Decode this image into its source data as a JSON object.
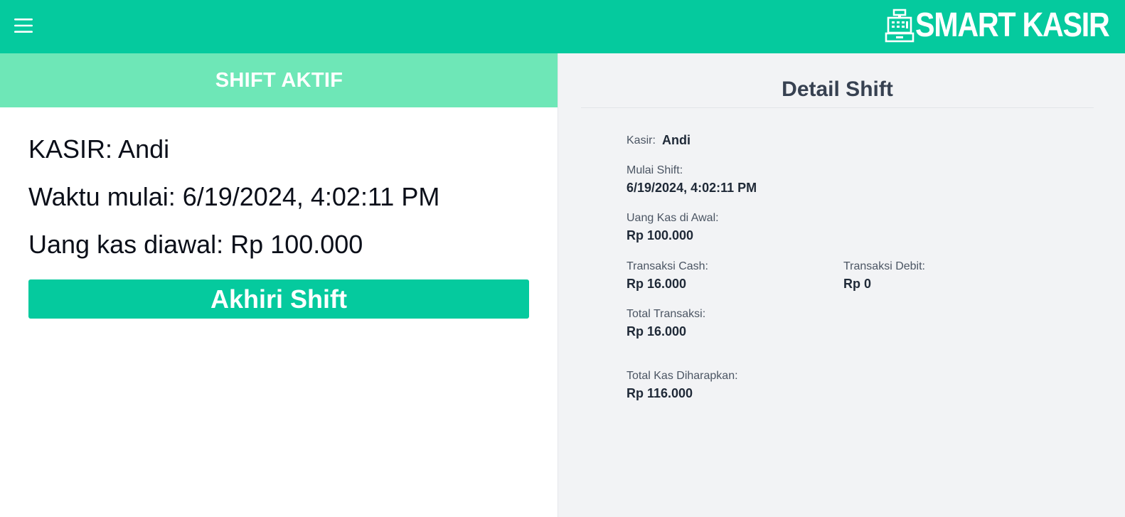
{
  "brand": {
    "name": "SMART KASIR",
    "color": "#05ca9e"
  },
  "icons": {
    "menu": "hamburger-menu-icon",
    "logo": "cash-register-icon"
  },
  "active_shift": {
    "header": "SHIFT AKTIF",
    "cashier_line": "KASIR: Andi",
    "start_line": "Waktu mulai: 6/19/2024, 4:02:11 PM",
    "cash_line": "Uang kas diawal: Rp 100.000",
    "end_button": "Akhiri Shift"
  },
  "detail": {
    "title": "Detail Shift",
    "cashier_label": "Kasir:",
    "cashier_value": "Andi",
    "start_label": "Mulai Shift:",
    "start_value": "6/19/2024, 4:02:11 PM",
    "opening_cash_label": "Uang Kas di Awal:",
    "opening_cash_value": "Rp 100.000",
    "cash_tx_label": "Transaksi Cash:",
    "cash_tx_value": "Rp 16.000",
    "debit_tx_label": "Transaksi Debit:",
    "debit_tx_value": "Rp 0",
    "total_tx_label": "Total Transaksi:",
    "total_tx_value": "Rp 16.000",
    "expected_cash_label": "Total Kas Diharapkan:",
    "expected_cash_value": "Rp 116.000"
  }
}
